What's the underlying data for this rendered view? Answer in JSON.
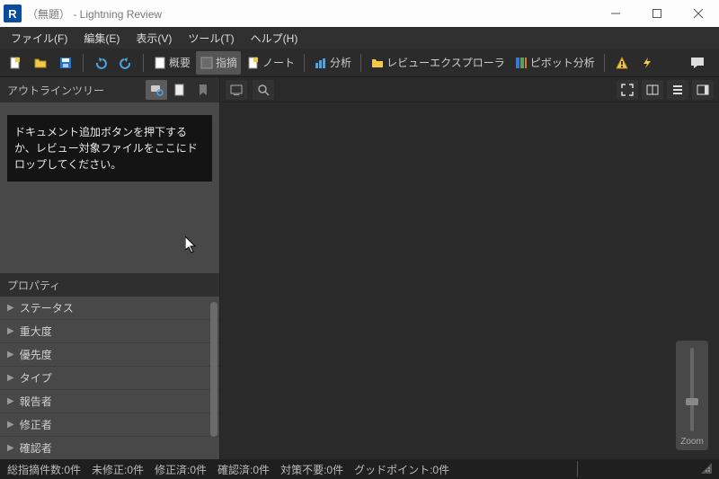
{
  "window": {
    "title": "（無題）  - Lightning Review",
    "app_icon_letter": "R"
  },
  "menu": {
    "file": "ファイル(F)",
    "edit": "編集(E)",
    "view": "表示(V)",
    "tools": "ツール(T)",
    "help": "ヘルプ(H)"
  },
  "toolbar": {
    "overview": "概要",
    "issue": "指摘",
    "note": "ノート",
    "analysis": "分析",
    "review_explorer": "レビューエクスプローラ",
    "pivot": "ピボット分析"
  },
  "outline": {
    "title": "アウトラインツリー",
    "drop_hint": "ドキュメント追加ボタンを押下するか、レビュー対象ファイルをここにドロップしてください。"
  },
  "props": {
    "title": "プロパティ",
    "items": [
      "ステータス",
      "重大度",
      "優先度",
      "タイプ",
      "報告者",
      "修正者",
      "確認者"
    ]
  },
  "zoom": {
    "label": "Zoom"
  },
  "status": {
    "total": "総指摘件数:0件",
    "unfixed": "未修正:0件",
    "fixed": "修正済:0件",
    "confirmed": "確認済:0件",
    "not_needed": "対策不要:0件",
    "good": "グッドポイント:0件"
  }
}
